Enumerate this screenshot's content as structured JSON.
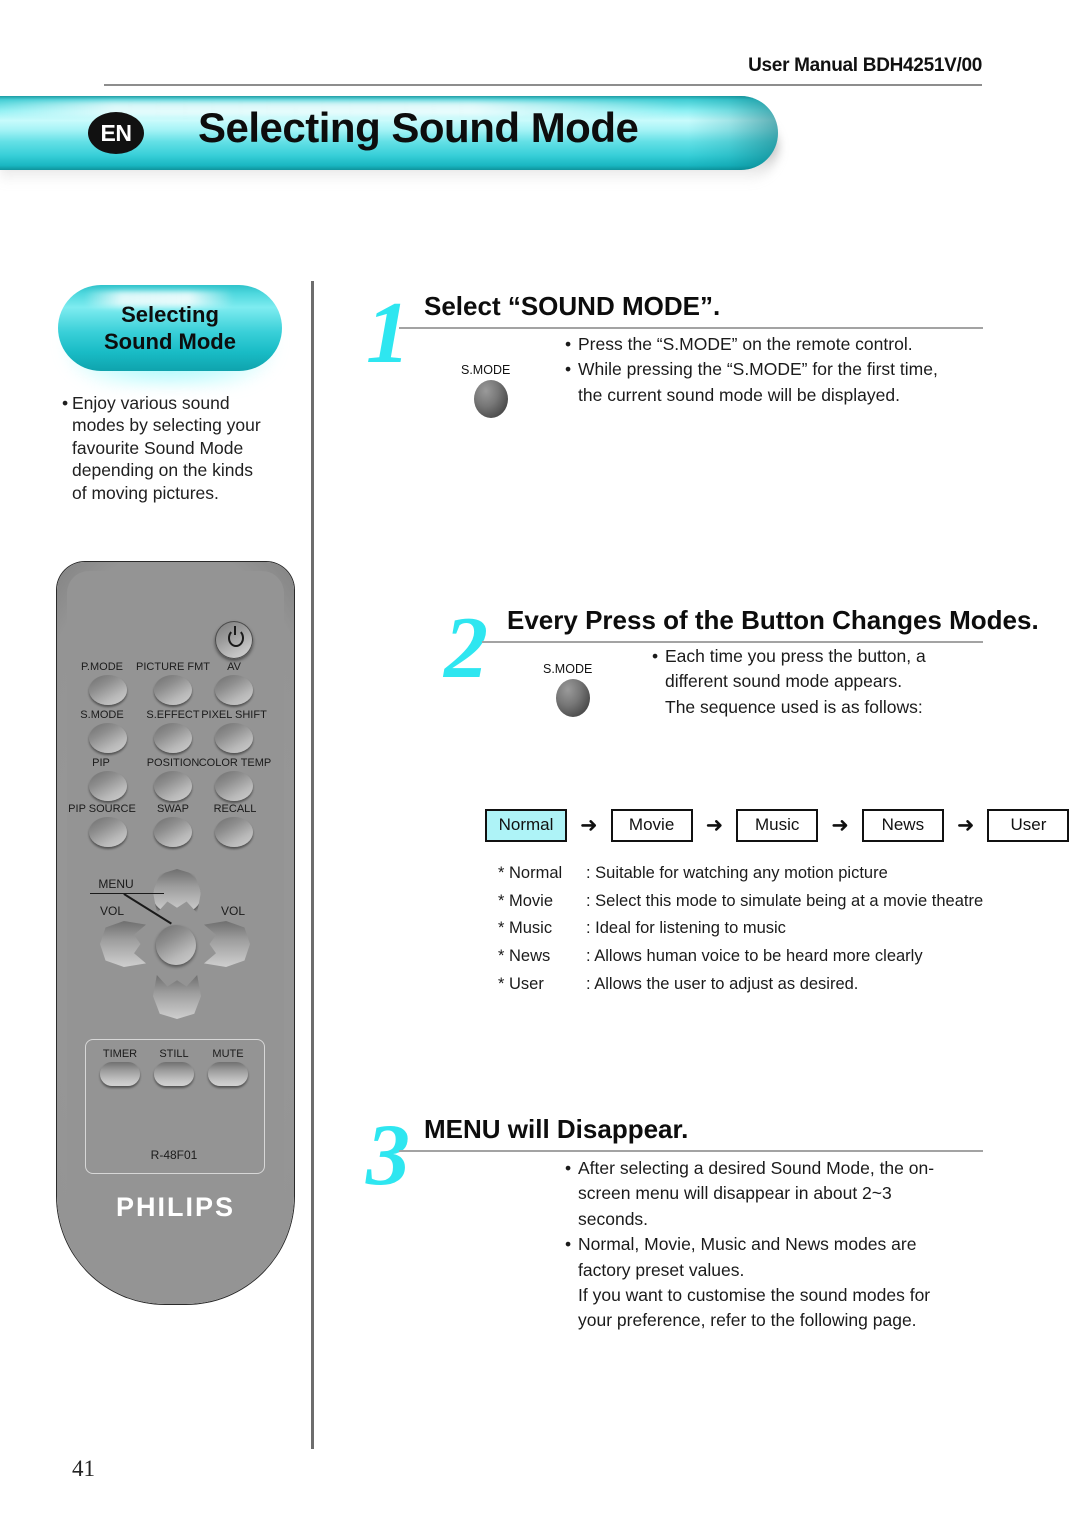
{
  "header": {
    "manual_title": "User Manual BDH4251V/00"
  },
  "banner": {
    "language_badge": "EN",
    "title": "Selecting Sound Mode",
    "color": "#3cd2da"
  },
  "sidebar": {
    "pill_line1": "Selecting",
    "pill_line2": "Sound Mode",
    "bullet": "•",
    "note": "Enjoy various sound modes by selecting your favourite Sound Mode depending on the kinds of moving pictures."
  },
  "remote": {
    "model": "R-48F01",
    "brand": "PHILIPS",
    "button_labels": {
      "p_mode": "P.MODE",
      "picture_fmt": "PICTURE FMT",
      "av": "AV",
      "s_mode": "S.MODE",
      "s_effect": "S.EFFECT",
      "pixel_shift": "PIXEL SHIFT",
      "pip": "PIP",
      "position": "POSITION",
      "color_temp": "COLOR TEMP",
      "pip_source": "PIP SOURCE",
      "swap": "SWAP",
      "recall": "RECALL",
      "menu": "MENU",
      "vol_left": "VOL",
      "vol_right": "VOL",
      "timer": "TIMER",
      "still": "STILL",
      "mute": "MUTE"
    }
  },
  "steps": [
    {
      "number": "1",
      "heading": "Select “SOUND MODE”.",
      "button_caption": "S.MODE",
      "bullets": [
        "Press the “S.MODE” on the remote control.",
        "While pressing the “S.MODE” for the first time, the current sound mode will be displayed."
      ]
    },
    {
      "number": "2",
      "heading": "Every Press of the Button Changes Modes.",
      "button_caption": "S.MODE",
      "bullets": [
        "Each time you press the button, a different sound mode appears."
      ],
      "continuation": "The sequence used is as follows:"
    },
    {
      "number": "3",
      "heading": "MENU will Disappear.",
      "bullets": [
        "After selecting a desired Sound Mode, the on-screen menu will disappear in about 2~3 seconds.",
        "Normal, Movie, Music and News modes are factory preset values."
      ],
      "continuation": "If you want to customise the sound modes for your preference, refer to the following page."
    }
  ],
  "sequence": {
    "arrow": "➜",
    "items": [
      {
        "label": "Normal",
        "active": true
      },
      {
        "label": "Movie",
        "active": false
      },
      {
        "label": "Music",
        "active": false
      },
      {
        "label": "News",
        "active": false
      },
      {
        "label": "User",
        "active": false
      }
    ]
  },
  "mode_definitions": [
    {
      "key": "* Normal",
      "value": ": Suitable for watching any motion picture"
    },
    {
      "key": "* Movie",
      "value": ": Select this mode to simulate being at a movie theatre"
    },
    {
      "key": "* Music",
      "value": ": Ideal for listening to music"
    },
    {
      "key": "* News",
      "value": ": Allows human voice to be heard more clearly"
    },
    {
      "key": "* User",
      "value": ": Allows the user to adjust as desired."
    }
  ],
  "bullet_char": "•",
  "page_number": "41"
}
